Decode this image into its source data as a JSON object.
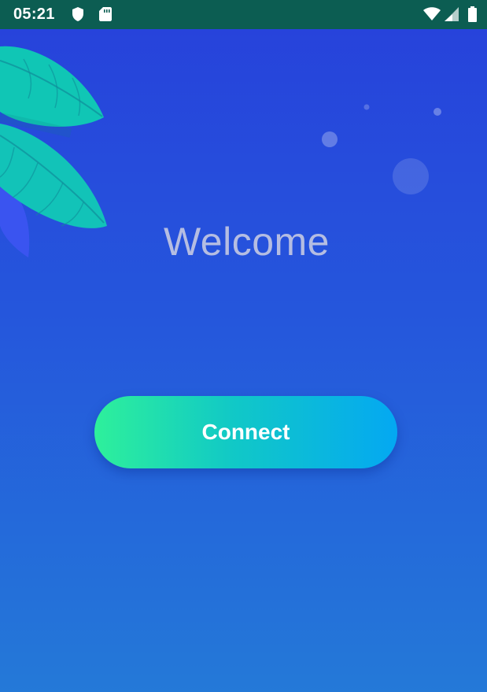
{
  "status_bar": {
    "time": "05:21",
    "icons": [
      "shield-icon",
      "sd-card-icon",
      "wifi-icon",
      "signal-icon",
      "battery-icon"
    ],
    "background": "#0c5d52"
  },
  "main": {
    "title": "Welcome",
    "connect_label": "Connect"
  },
  "colors": {
    "background_top": "#2741db",
    "background_bottom": "#2479d8",
    "title": "#b5bde2",
    "button_start": "#2ef09b",
    "button_end": "#04a8f2",
    "leaf": "#14c9b6"
  }
}
